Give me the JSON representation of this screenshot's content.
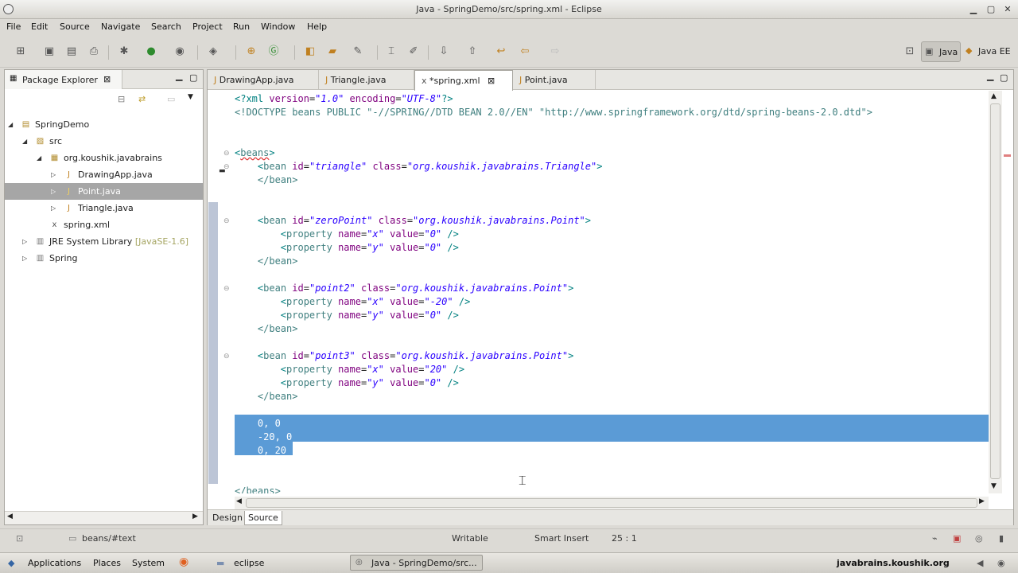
{
  "window": {
    "title": "Java - SpringDemo/src/spring.xml - Eclipse"
  },
  "menubar": [
    "File",
    "Edit",
    "Source",
    "Navigate",
    "Search",
    "Project",
    "Run",
    "Window",
    "Help"
  ],
  "perspectives": {
    "java": "Java",
    "javaee": "Java EE"
  },
  "package_explorer": {
    "title": "Package Explorer",
    "tree": [
      {
        "label": "SpringDemo",
        "icon": "project-icon"
      },
      {
        "label": "src",
        "icon": "source-folder-icon"
      },
      {
        "label": "org.koushik.javabrains",
        "icon": "package-icon"
      },
      {
        "label": "DrawingApp.java",
        "icon": "java-file-icon"
      },
      {
        "label": "Point.java",
        "icon": "java-file-icon"
      },
      {
        "label": "Triangle.java",
        "icon": "java-file-icon"
      },
      {
        "label": "spring.xml",
        "icon": "xml-file-icon"
      },
      {
        "label": "JRE System Library",
        "decoration": "[JavaSE-1.6]",
        "icon": "library-icon"
      },
      {
        "label": "Spring",
        "icon": "library-icon"
      }
    ]
  },
  "editor": {
    "tabs": [
      "DrawingApp.java",
      "Triangle.java",
      "*spring.xml",
      "Point.java"
    ],
    "active_tab": "*spring.xml",
    "lines": {
      "l1a": "<?xml ",
      "l1b": "version",
      "l1c": "=",
      "l1d": "\"1.0\"",
      "l1e": " encoding",
      "l1f": "=",
      "l1g": "\"UTF-8\"",
      "l1h": "?>",
      "l2": "<!DOCTYPE beans PUBLIC \"-//SPRING//DTD BEAN 2.0//EN\" \"http://www.springframework.org/dtd/spring-beans-2.0.dtd\">",
      "beans_open": "beans",
      "bean": "bean",
      "id": "id",
      "class": "class",
      "property": "property",
      "name": "name",
      "value": "value",
      "close_bean": "</bean>",
      "triangle_id": "\"triangle\"",
      "triangle_class": "\"org.koushik.javabrains.Triangle\"",
      "zero_id": "\"zeroPoint\"",
      "point_class": "\"org.koushik.javabrains.Point\"",
      "point2_id": "\"point2\"",
      "point3_id": "\"point3\"",
      "x": "\"x\"",
      "y": "\"y\"",
      "v0": "\"0\"",
      "vneg20": "\"-20\"",
      "v20": "\"20\"",
      "sel1": "    0, 0",
      "sel2": "    -20, 0",
      "sel3": "    0, 20",
      "beans_close": "</beans>"
    },
    "bottom_tabs": [
      "Design",
      "Source"
    ]
  },
  "statusbar": {
    "path": "beans/#text",
    "writable": "Writable",
    "insert": "Smart Insert",
    "position": "25 : 1"
  },
  "panel": {
    "applications": "Applications",
    "places": "Places",
    "system": "System",
    "eclipse": "eclipse",
    "task": "Java - SpringDemo/src...",
    "site": "javabrains.koushik.org"
  }
}
